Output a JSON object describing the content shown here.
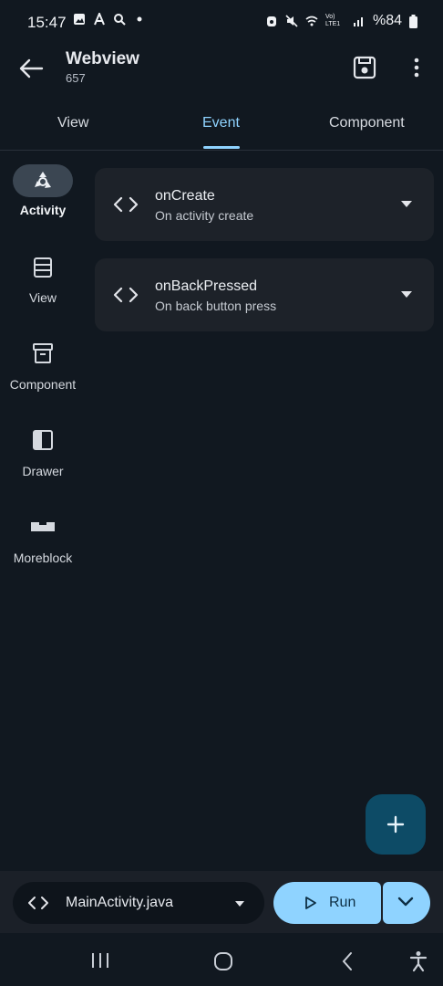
{
  "status_bar": {
    "time": "15:47",
    "battery": "%84",
    "volte": "Vo) LTE1"
  },
  "app_bar": {
    "title": "Webview",
    "subtitle": "657"
  },
  "tabs": [
    {
      "label": "View"
    },
    {
      "label": "Event",
      "active": true
    },
    {
      "label": "Component"
    }
  ],
  "rail": [
    {
      "label": "Activity",
      "icon": "recycle-icon",
      "active": true
    },
    {
      "label": "View",
      "icon": "list-icon"
    },
    {
      "label": "Component",
      "icon": "archive-icon"
    },
    {
      "label": "Drawer",
      "icon": "drawer-icon"
    },
    {
      "label": "Moreblock",
      "icon": "block-icon"
    }
  ],
  "events": [
    {
      "title": "onCreate",
      "description": "On activity create"
    },
    {
      "title": "onBackPressed",
      "description": "On back button press"
    }
  ],
  "bottom": {
    "file": "MainActivity.java",
    "run_label": "Run"
  },
  "colors": {
    "accent": "#8fd3ff",
    "background": "#111820",
    "card": "#1d2229",
    "fab": "#0d4b66"
  }
}
